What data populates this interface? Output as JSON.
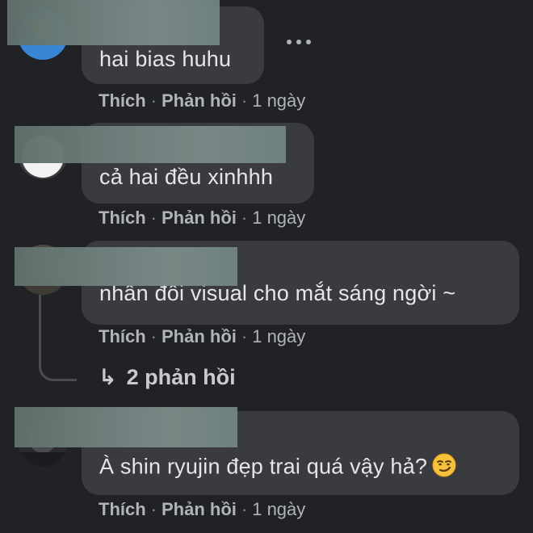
{
  "comments": [
    {
      "text": "hai bias huhu",
      "like_label": "Thích",
      "reply_label": "Phản hồi",
      "separator": "·",
      "time": "1 ngày"
    },
    {
      "text": "cả hai đều xinhhh",
      "like_label": "Thích",
      "reply_label": "Phản hồi",
      "separator": "·",
      "time": "1 ngày"
    },
    {
      "text": "nhân đôi visual cho mắt sáng ngời ~",
      "like_label": "Thích",
      "reply_label": "Phản hồi",
      "separator": "·",
      "time": "1 ngày",
      "replies_label": "2 phản hồi",
      "replies_arrow": "↳"
    },
    {
      "text": "À shin ryujin đẹp trai quá vậy hả?",
      "like_label": "Thích",
      "reply_label": "Phản hồi",
      "separator": "·",
      "time": "1 ngày",
      "emoji": "smirk-emoji"
    }
  ],
  "more_menu": {
    "icon": "more-horizontal-icon"
  },
  "colors": {
    "background": "#212226",
    "bubble": "#3a3b3f",
    "text": "#e4e6eb",
    "meta": "#b0b3b8",
    "redaction": "#6f807d"
  }
}
